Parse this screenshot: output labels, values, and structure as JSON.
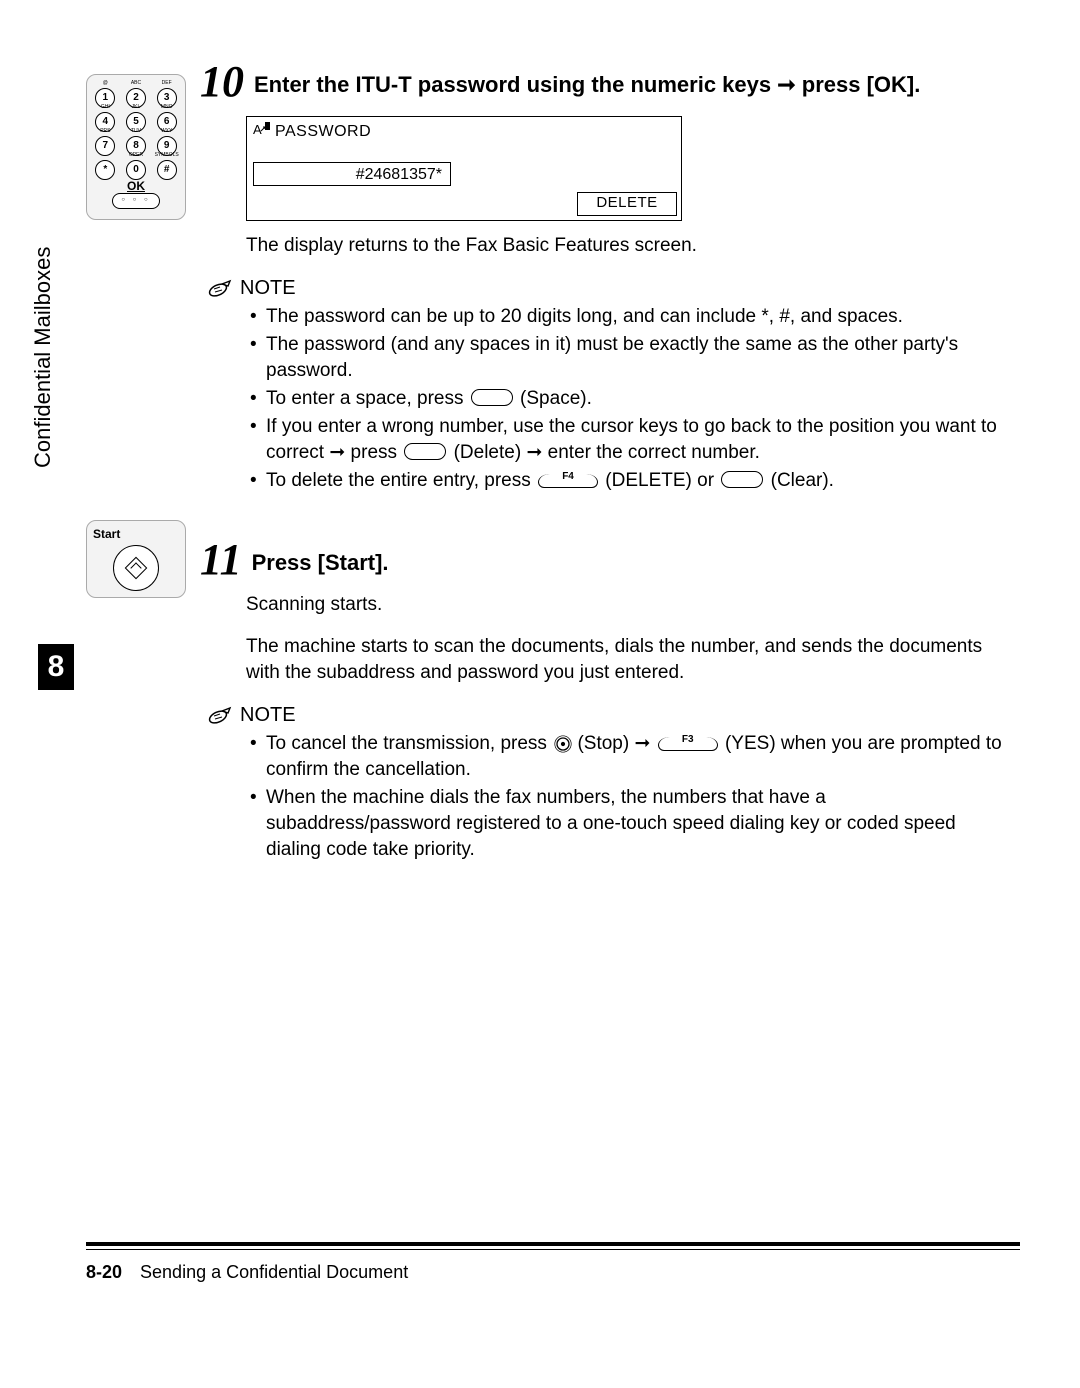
{
  "sidebar": {
    "section": "Confidential Mailboxes",
    "chapter": "8"
  },
  "keypad": {
    "subs": [
      "@",
      "ABC",
      "DEF",
      "GHI",
      "JKL",
      "MNO",
      "PRS",
      "TUV",
      "WXY",
      "",
      "OPER",
      "SYMBOLS"
    ],
    "keys": [
      "1",
      "2",
      "3",
      "4",
      "5",
      "6",
      "7",
      "8",
      "9",
      "*",
      "0",
      "#"
    ],
    "ok": "OK",
    "okdots": "○ ○ ○"
  },
  "start_box": {
    "label": "Start"
  },
  "step10": {
    "num": "10",
    "title_a": "Enter the ITU-T password using the numeric keys ",
    "title_arrow": "➞",
    "title_b": " press [OK].",
    "screen": {
      "title": "PASSWORD",
      "value": "#24681357*",
      "delete": "DELETE"
    },
    "caption": "The display returns to the Fax Basic Features screen.",
    "note_label": "NOTE",
    "notes": {
      "n1": "The password can be up to 20 digits long, and can include *, #, and spaces.",
      "n2": "The password (and any spaces in it) must be exactly the same as the other party's password.",
      "n3a": "To enter a space, press ",
      "n3b": " (Space).",
      "n4a": "If you enter a wrong number, use the cursor keys to go back to the position you want to correct ",
      "n4arrow1": "➞",
      "n4b": " press ",
      "n4c": " (Delete) ",
      "n4arrow2": "➞",
      "n4d": " enter the correct number.",
      "n5a": "To delete the entire entry, press ",
      "n5b": " (DELETE) or ",
      "n5c": " (Clear)."
    }
  },
  "step11": {
    "num": "11",
    "title": "Press [Start].",
    "body1": "Scanning starts.",
    "body2": "The machine starts to scan the documents, dials the number, and sends the documents with the subaddress and password you just entered.",
    "note_label": "NOTE",
    "notes": {
      "n1a": "To cancel the transmission, press ",
      "n1b": " (Stop) ",
      "n1arrow": "➞",
      "n1c": "  (YES) when you are prompted to confirm the cancellation.",
      "n2": "When the machine dials the fax numbers, the numbers that have a subaddress/password registered to a one-touch speed dialing key or coded speed dialing code take priority."
    }
  },
  "footer": {
    "page": "8-20",
    "title": "Sending a Confidential Document"
  }
}
